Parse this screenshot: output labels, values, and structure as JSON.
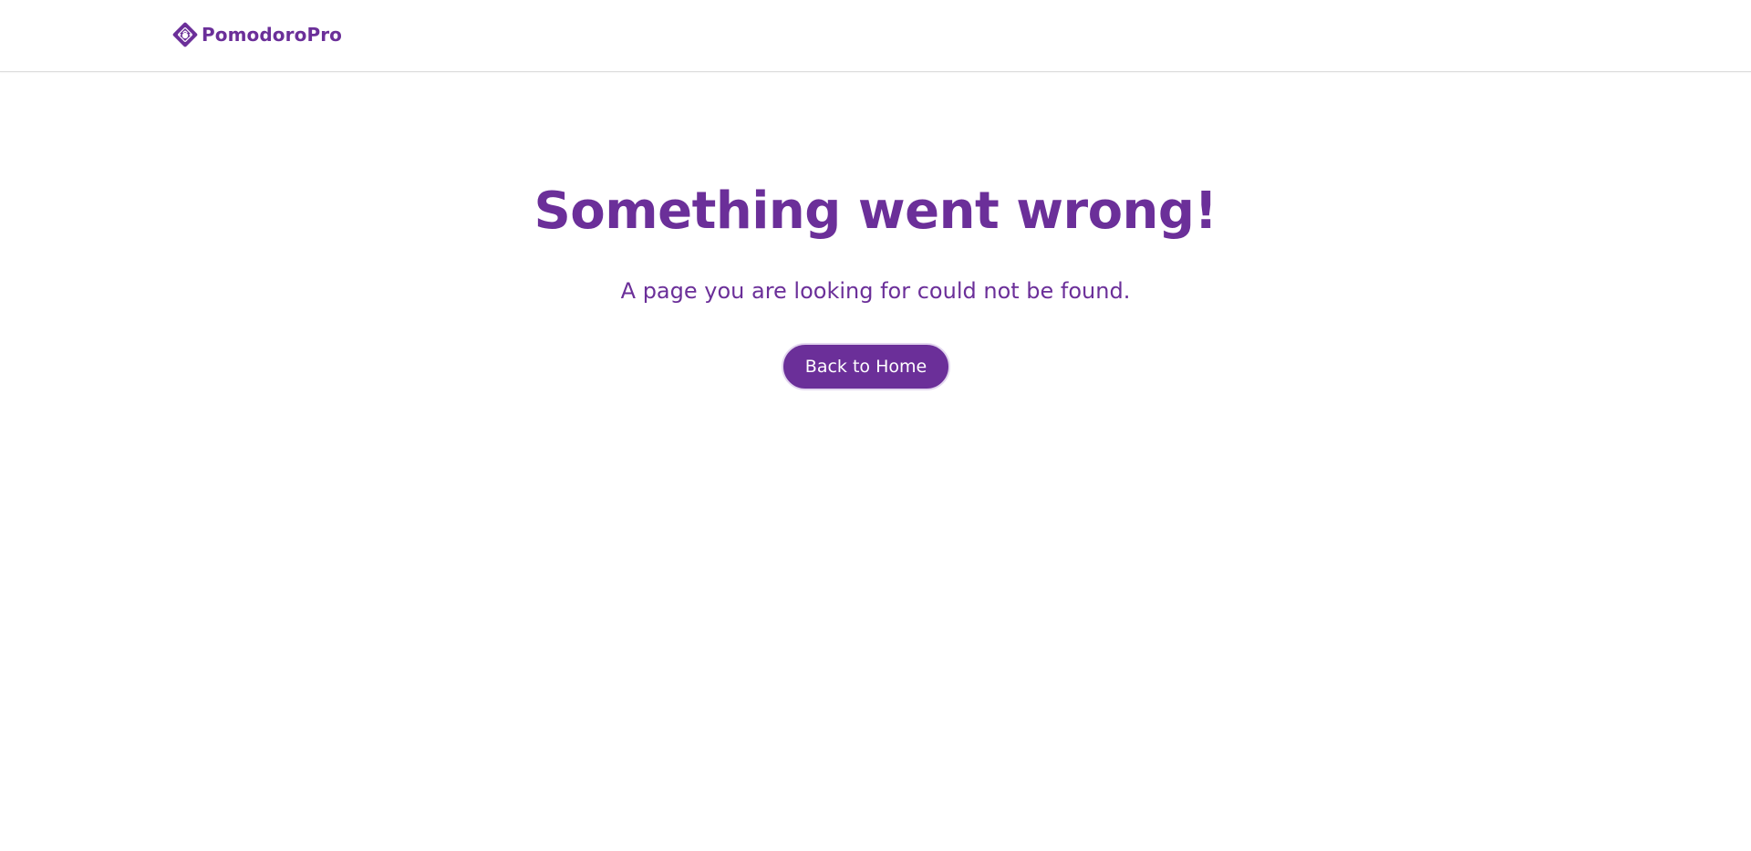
{
  "brand": {
    "name": "PomodoroPro",
    "icon": "pomodoro-logo-icon",
    "color": "#6b2f99"
  },
  "error": {
    "title": "Something went wrong!",
    "message": "A page you are looking for could not be found.",
    "button_label": "Back to Home"
  },
  "colors": {
    "accent": "#6b2f99",
    "background": "#ffffff",
    "button_text": "#ffffff"
  }
}
